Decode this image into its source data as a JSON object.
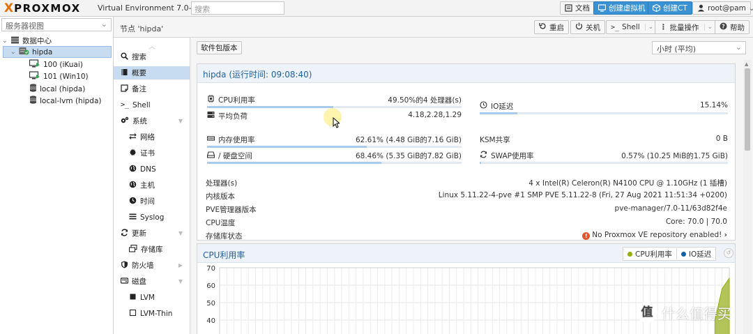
{
  "app": {
    "logo_x": "X",
    "logo_word": "PROXMOX",
    "subtitle": "Virtual Environment 7.0-11",
    "search_placeholder": "搜索"
  },
  "topbar": {
    "docs": "文档",
    "create_vm": "创建虚拟机",
    "create_ct": "创建CT",
    "user": "root@pam",
    "user_chevron": "⌄"
  },
  "tree": {
    "view_select": "服务器视图",
    "datacenter": "数据中心",
    "node": "hipda",
    "items": [
      {
        "label": "100 (iKuai)",
        "icon": "vm-running-icon"
      },
      {
        "label": "101 (Win10)",
        "icon": "vm-running-icon"
      },
      {
        "label": "local (hipda)",
        "icon": "storage-icon"
      },
      {
        "label": "local-lvm (hipda)",
        "icon": "storage-icon"
      }
    ]
  },
  "header": {
    "title": "节点 'hipda'",
    "restart": "重启",
    "shutdown": "关机",
    "shell": "Shell",
    "bulk": "批量操作",
    "help": "帮助"
  },
  "subnav": {
    "items": [
      {
        "label": "搜索",
        "icon": "search-icon"
      },
      {
        "label": "概要",
        "icon": "book-icon"
      },
      {
        "label": "备注",
        "icon": "note-icon"
      },
      {
        "label": "Shell",
        "icon": "terminal-icon"
      },
      {
        "label": "系统",
        "icon": "gears-icon"
      },
      {
        "label": "网络",
        "icon": "network-icon"
      },
      {
        "label": "证书",
        "icon": "certificate-icon"
      },
      {
        "label": "DNS",
        "icon": "globe-icon"
      },
      {
        "label": "主机",
        "icon": "globe-icon"
      },
      {
        "label": "时间",
        "icon": "clock-icon"
      },
      {
        "label": "Syslog",
        "icon": "list-icon"
      },
      {
        "label": "更新",
        "icon": "refresh-icon"
      },
      {
        "label": "存储库",
        "icon": "repository-icon"
      },
      {
        "label": "防火墙",
        "icon": "shield-icon"
      },
      {
        "label": "磁盘",
        "icon": "disk-icon"
      },
      {
        "label": "LVM",
        "icon": "square-icon"
      },
      {
        "label": "LVM-Thin",
        "icon": "square-outline-icon"
      }
    ]
  },
  "toolbar": {
    "package_versions": "软件包版本",
    "timeframe": "小时 (平均)"
  },
  "summary": {
    "title": "hipda (运行时间: 09:08:40)",
    "cpu": {
      "label": "CPU利用率",
      "value": "49.50%的4 处理器(s)",
      "fraction": 0.495
    },
    "io_delay": {
      "label": "IO延迟",
      "value": "15.14%",
      "fraction": 0.1514
    },
    "load": {
      "label": "平均负荷",
      "value": "4.18,2.28,1.29"
    },
    "memory": {
      "label": "内存使用率",
      "value": "62.61% (4.48 GiB的7.16 GiB)",
      "fraction": 0.6261
    },
    "ksm": {
      "label": "KSM共享",
      "value": "0 B"
    },
    "disk": {
      "label": "/ 硬盘空间",
      "value": "68.46% (5.35 GiB的7.82 GiB)",
      "fraction": 0.6846
    },
    "swap": {
      "label": "SWAP使用率",
      "value": "0.57% (10.25 MiB的1.75 GiB)",
      "fraction": 0.0057
    },
    "info": [
      {
        "k": "处理器(s)",
        "v": "4 x Intel(R) Celeron(R) N4100 CPU @ 1.10GHz (1 插槽)"
      },
      {
        "k": "内核版本",
        "v": "Linux 5.11.22-4-pve #1 SMP PVE 5.11.22-8 (Fri, 27 Aug 2021 11:51:34 +0200)"
      },
      {
        "k": "PVE管理器版本",
        "v": "pve-manager/7.0-11/63d82f4e"
      },
      {
        "k": "CPU温度",
        "v": "Core: 70.0 | 70.0"
      },
      {
        "k": "存储库状态",
        "v": "No Proxmox VE repository enabled!"
      }
    ]
  },
  "chart_panel": {
    "title": "CPU利用率",
    "legend": [
      {
        "name": "CPU利用率",
        "color": "#94ae0a"
      },
      {
        "name": "IO延迟",
        "color": "#115fa6"
      }
    ]
  },
  "chart_data": {
    "type": "area",
    "title": "CPU利用率",
    "yticks": [
      70,
      60,
      50,
      40
    ],
    "grid": true,
    "legend_placement": "top-right",
    "series": [
      {
        "name": "CPU利用率",
        "values": [
          0,
          0,
          0,
          0,
          0,
          0,
          0,
          0,
          0,
          0,
          0,
          0,
          0,
          0,
          0,
          0,
          0,
          0,
          0,
          0,
          0,
          0,
          0,
          0,
          0,
          0,
          0,
          0,
          0,
          0,
          0,
          0,
          0,
          0,
          0,
          0,
          0,
          0,
          0,
          0,
          0,
          0,
          0,
          0,
          0,
          0,
          0,
          0,
          0,
          0,
          0,
          0,
          0,
          0,
          0,
          0,
          0,
          0,
          0,
          0,
          0,
          0,
          0,
          0,
          0,
          0,
          0,
          0,
          0,
          40,
          58,
          64
        ]
      }
    ]
  },
  "watermark": {
    "badge": "值",
    "text": "什么值得买"
  }
}
